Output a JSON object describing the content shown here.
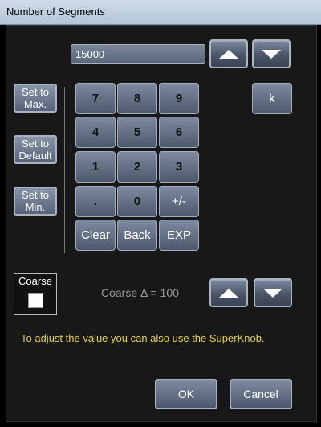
{
  "window": {
    "title": "Number of Segments"
  },
  "value": {
    "text": "15000"
  },
  "side_buttons": {
    "set_max": "Set to\nMax.",
    "set_default": "Set to\nDefault",
    "set_min": "Set to\nMin."
  },
  "keypad": {
    "row1": [
      "7",
      "8",
      "9"
    ],
    "row2": [
      "4",
      "5",
      "6"
    ],
    "row3": [
      "1",
      "2",
      "3"
    ],
    "row4": [
      ".",
      "0",
      "+/-"
    ],
    "row5": [
      "Clear",
      "Back",
      "EXP"
    ],
    "k": "k"
  },
  "coarse": {
    "label": "Coarse",
    "checked": false,
    "delta_text": "Coarse Δ = 100"
  },
  "hint": "To adjust the value you can also use the SuperKnob.",
  "footer": {
    "ok": "OK",
    "cancel": "Cancel"
  },
  "icons": {
    "up": "arrow-up-icon",
    "down": "arrow-down-icon"
  }
}
